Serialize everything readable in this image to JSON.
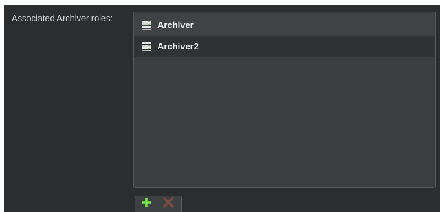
{
  "field": {
    "label": "Associated Archiver roles:"
  },
  "archivers": {
    "items": [
      {
        "label": "Archiver",
        "icon": "server-icon"
      },
      {
        "label": "Archiver2",
        "icon": "server-icon"
      }
    ]
  },
  "toolbar": {
    "add_icon": "plus-icon",
    "remove_icon": "close-icon"
  },
  "colors": {
    "panel_background": "#2b2e30",
    "list_background": "#3a3e41",
    "add_green": "#5fcf3a",
    "remove_brown": "#7a4c40"
  }
}
